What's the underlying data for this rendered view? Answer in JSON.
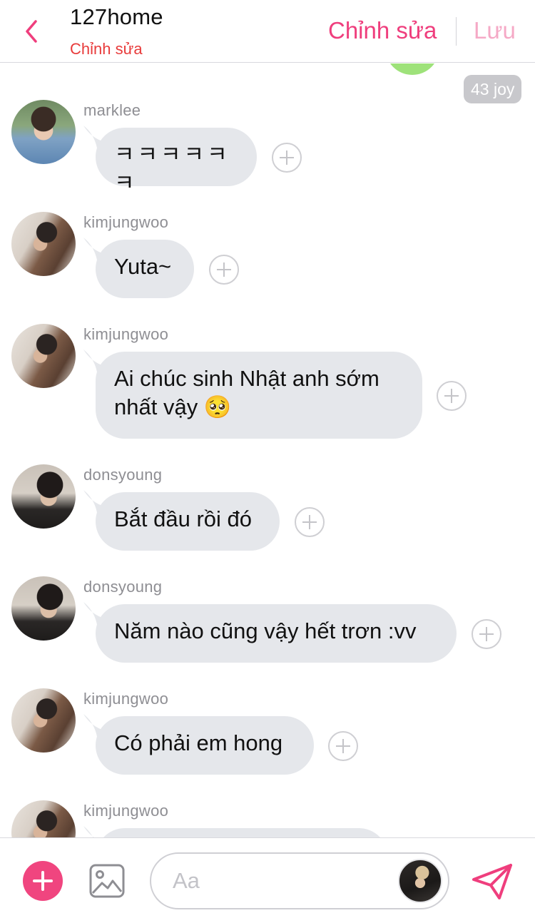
{
  "header": {
    "title": "127home",
    "subtitle": "Chỉnh sửa",
    "edit_label": "Chỉnh sửa",
    "save_label": "Lưu",
    "accent_color": "#ef3e7d"
  },
  "chat": {
    "reaction_badge": "43 joy",
    "messages": [
      {
        "sender": "marklee",
        "text": "ㅋㅋㅋㅋㅋㅋ",
        "avatar": "avatar-marklee"
      },
      {
        "sender": "kimjungwoo",
        "text": "Yuta~",
        "avatar": "avatar-kimjungwoo"
      },
      {
        "sender": "kimjungwoo",
        "text": "Ai chúc sinh Nhật anh sớm",
        "text2": "nhất vậy 🥺",
        "avatar": "avatar-kimjungwoo"
      },
      {
        "sender": "donsyoung",
        "text": "Bắt đầu rồi đó",
        "avatar": "avatar-donsyoung"
      },
      {
        "sender": "donsyoung",
        "text": "Năm nào cũng vậy hết trơn :vv",
        "avatar": "avatar-donsyoung"
      },
      {
        "sender": "kimjungwoo",
        "text": "Có phải em hong",
        "avatar": "avatar-kimjungwoo"
      },
      {
        "sender": "kimjungwoo",
        "text": "",
        "avatar": "avatar-kimjungwoo"
      }
    ]
  },
  "composer": {
    "placeholder": "Aa",
    "icons": [
      "plus-icon",
      "image-icon",
      "send-icon"
    ]
  }
}
